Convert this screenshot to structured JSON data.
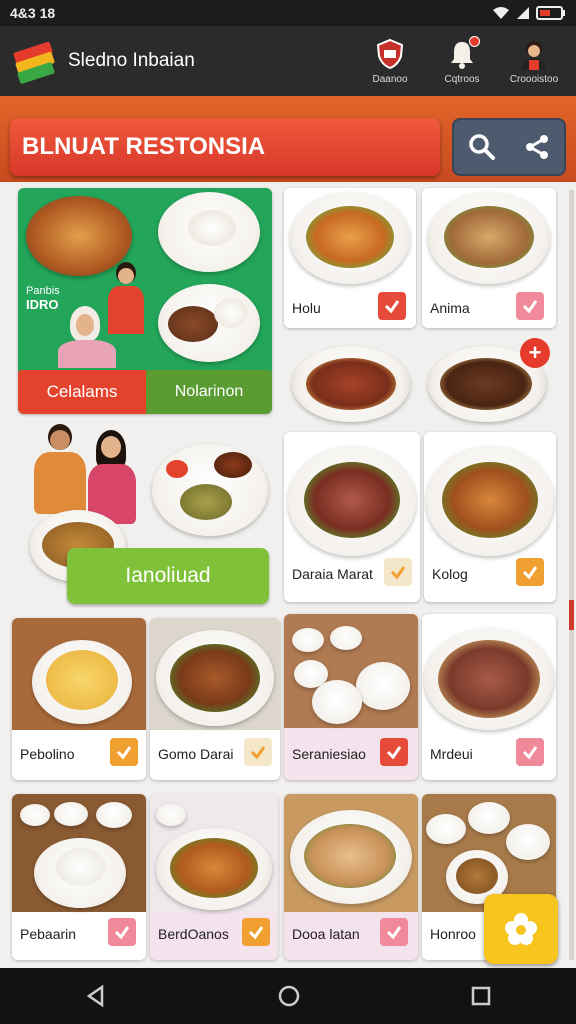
{
  "status_bar": {
    "time": "4&3 18"
  },
  "app": {
    "title": "Sledno Inbaian"
  },
  "nav": [
    {
      "label": "Daanoo",
      "icon": "shield-icon"
    },
    {
      "label": "Cqtroos",
      "icon": "bell-icon"
    },
    {
      "label": "Croooistoo",
      "icon": "chef-avatar-icon"
    }
  ],
  "banner": {
    "title": "BLNUAT RESTONSIA"
  },
  "promo": {
    "left_button": "Celalams",
    "right_button": "Nolarinon",
    "side_text_1": "Panbis",
    "side_text_2": "IDRO"
  },
  "feature": {
    "button": "Ianoliuad"
  },
  "items": [
    {
      "name": "Holu",
      "checked": true,
      "style": "red"
    },
    {
      "name": "Anima",
      "checked": true,
      "style": "pink"
    },
    {
      "name": "Daraia Marat",
      "checked": true,
      "style": "orange"
    },
    {
      "name": "Kolog",
      "checked": true,
      "style": "orange"
    },
    {
      "name": "Pebolino",
      "checked": true,
      "style": "orange"
    },
    {
      "name": "Gomo Darai",
      "checked": true,
      "style": "orange"
    },
    {
      "name": "Seraniesiao",
      "checked": true,
      "style": "red"
    },
    {
      "name": "Mrdeui",
      "checked": true,
      "style": "pink"
    },
    {
      "name": "Pebaarin",
      "checked": true,
      "style": "pink"
    },
    {
      "name": "BerdOanos",
      "checked": true,
      "style": "orange"
    },
    {
      "name": "Dooa latan",
      "checked": true,
      "style": "pink"
    },
    {
      "name": "Honroo",
      "checked": false,
      "style": "none"
    }
  ],
  "colors": {
    "accent": "#e2652a",
    "appbar": "#2b2b2b",
    "banner": "#e3432d",
    "check_red": "#e54a3a",
    "check_orange": "#f0a030",
    "check_pink": "#f08a9a"
  }
}
